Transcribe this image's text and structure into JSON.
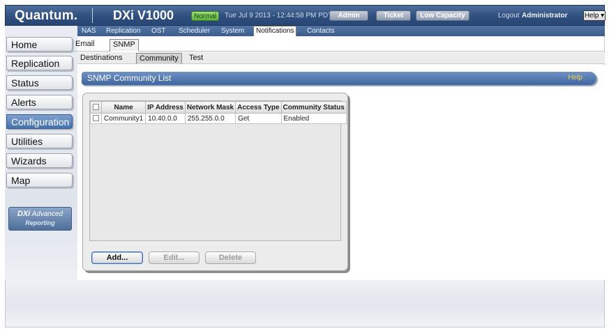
{
  "header": {
    "logo": "Quantum.",
    "product": "DXi V1000",
    "status_badge": "Normal",
    "datetime": "Tue Jul 9 2013 - 12:44:58 PM PDT",
    "buttons": [
      "Admin",
      "Ticket",
      "Low Capacity"
    ],
    "logout": "Logout",
    "user": "Administrator",
    "help_menu": "Help ▾"
  },
  "sidebar": {
    "items": [
      "Home",
      "Replication",
      "Status",
      "Alerts",
      "Configuration",
      "Utilities",
      "Wizards",
      "Map"
    ],
    "active": "Configuration",
    "advanced_reporting": {
      "line1_brand": "DXi",
      "line1_rest": " Advanced",
      "line2": "Reporting"
    }
  },
  "tabs": [
    "NAS",
    "Replication",
    "OST",
    "Scheduler",
    "System",
    "Notifications",
    "Contacts"
  ],
  "active_tab": "Notifications",
  "subtabs": [
    "Email",
    "SNMP"
  ],
  "active_subtab": "SNMP",
  "subtabs2": [
    "Destinations",
    "Community",
    "Test"
  ],
  "active_subtab2": "Community",
  "section": {
    "title": "SNMP Community List",
    "help": "Help"
  },
  "table": {
    "columns": [
      "Name",
      "IP Address",
      "Network Mask",
      "Access Type",
      "Community Status"
    ],
    "rows": [
      {
        "name": "Community1",
        "ip": "10.40.0.0",
        "mask": "255.255.0.0",
        "access": "Get",
        "status": "Enabled"
      }
    ]
  },
  "actions": {
    "add": "Add...",
    "edit": "Edit...",
    "delete": "Delete"
  },
  "colors": {
    "header_blue": "#2f4f7e",
    "active_nav": "#4571ab",
    "status_green": "#5eb23c",
    "help_link": "#f2d84a"
  }
}
